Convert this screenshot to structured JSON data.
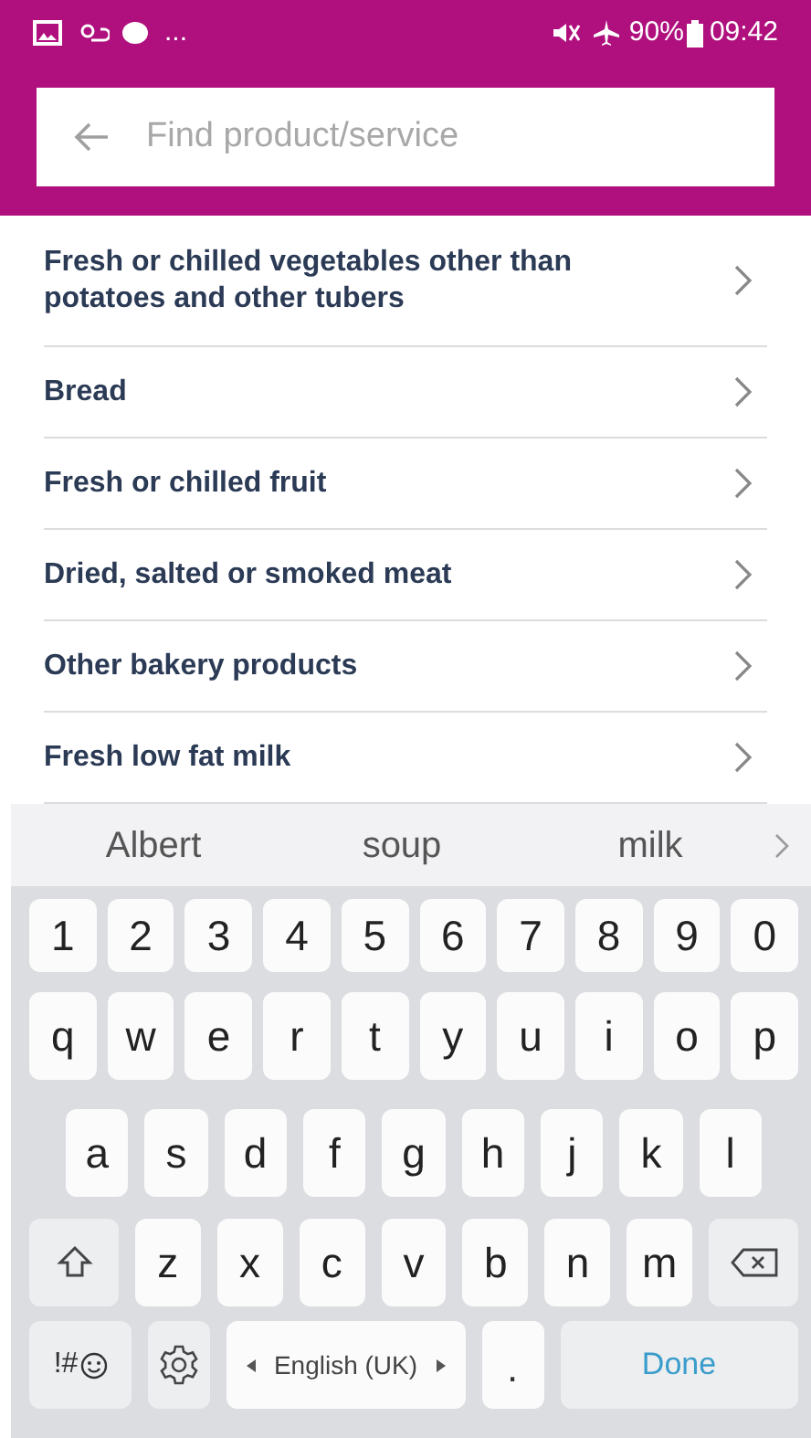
{
  "status_bar": {
    "overflow": "...",
    "battery": "90%",
    "time": "09:42"
  },
  "search": {
    "placeholder": "Find product/service"
  },
  "categories": [
    {
      "label": "Fresh or chilled vegetables other than potatoes and other tubers"
    },
    {
      "label": "Bread"
    },
    {
      "label": "Fresh or chilled fruit"
    },
    {
      "label": "Dried, salted or smoked meat"
    },
    {
      "label": "Other bakery products"
    },
    {
      "label": "Fresh low fat milk"
    }
  ],
  "keyboard": {
    "suggestions": [
      "Albert",
      "soup",
      "milk"
    ],
    "rows": [
      [
        "1",
        "2",
        "3",
        "4",
        "5",
        "6",
        "7",
        "8",
        "9",
        "0"
      ],
      [
        "q",
        "w",
        "e",
        "r",
        "t",
        "y",
        "u",
        "i",
        "o",
        "p"
      ],
      [
        "a",
        "s",
        "d",
        "f",
        "g",
        "h",
        "j",
        "k",
        "l"
      ],
      [
        "z",
        "x",
        "c",
        "v",
        "b",
        "n",
        "m"
      ]
    ],
    "symbols_key": "!#",
    "space_key": "English (UK)",
    "period_key": ".",
    "done_key": "Done"
  }
}
